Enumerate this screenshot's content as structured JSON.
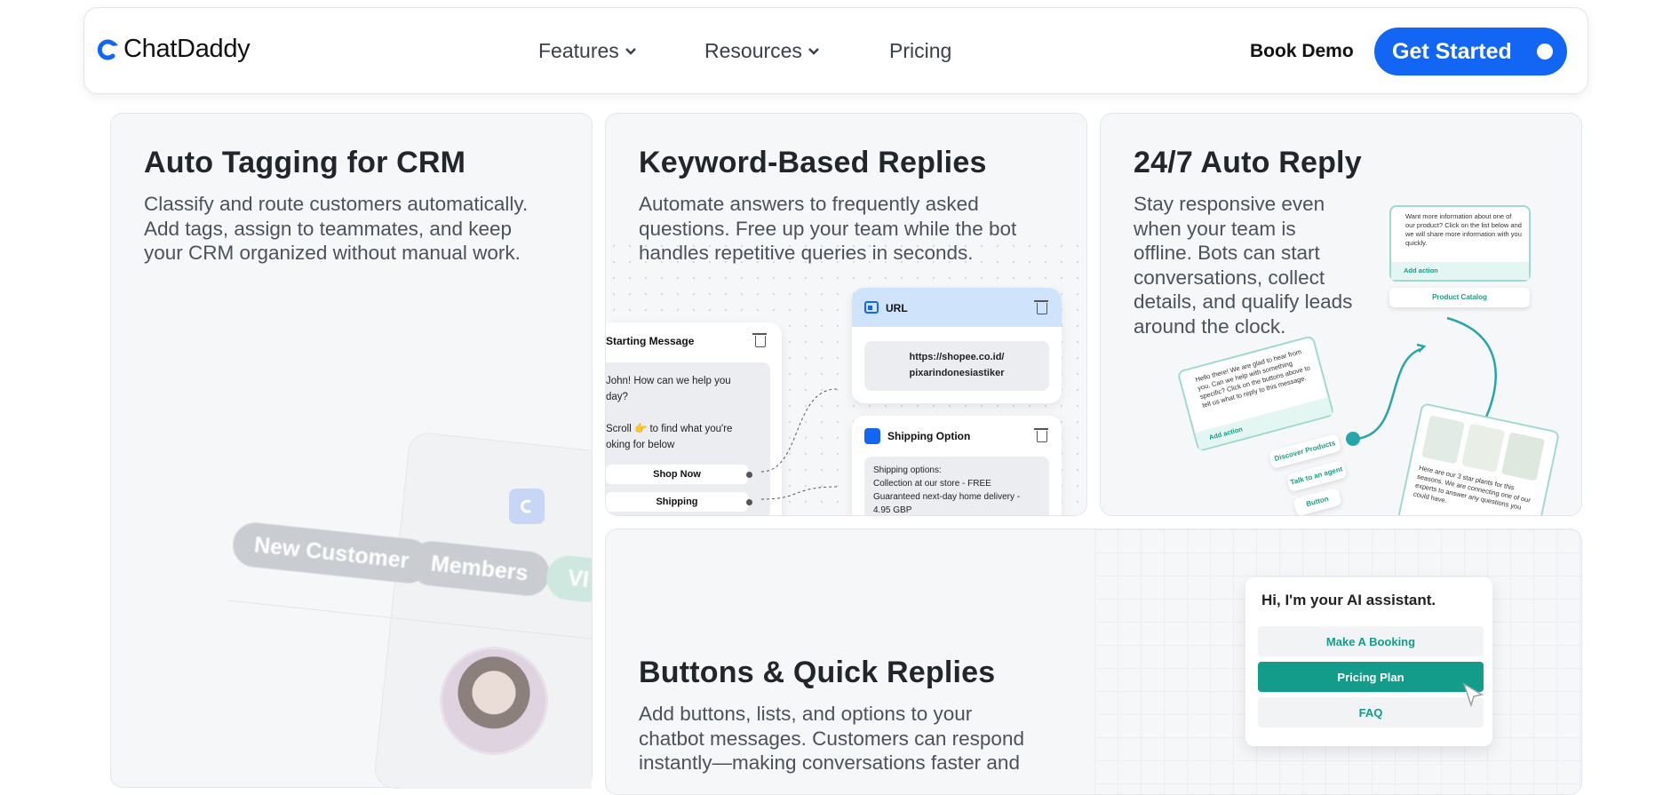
{
  "nav": {
    "brand": "ChatDaddy",
    "links": [
      "Features",
      "Resources",
      "Pricing"
    ],
    "book_demo": "Book Demo",
    "get_started": "Get Started"
  },
  "colors": {
    "accent": "#1366f4",
    "teal": "#149c8a",
    "card_bg": "#f6f7f9"
  },
  "cards": {
    "auto_tagging": {
      "title": "Auto Tagging for CRM",
      "lines": [
        "Classify and route customers automatically.",
        "Add tags, assign to teammates, and keep",
        "your CRM organized without manual work."
      ],
      "tags": [
        "New Customer",
        "Members",
        "VI"
      ]
    },
    "keyword": {
      "title": "Keyword-Based Replies",
      "lines": [
        "Automate answers to frequently asked",
        "questions. Free up your team while the bot",
        "handles repetitive queries in seconds."
      ],
      "start_msg": {
        "head": "Starting Message",
        "body1": "John! How can we help you",
        "body2": "day?",
        "body3": "Scroll 👉 to find what you're",
        "body4": "oking for below",
        "btn1": "Shop Now",
        "btn2": "Shipping"
      },
      "url_card": {
        "head": "URL",
        "value1": "https://shopee.co.id/",
        "value2": "pixarindonesiastiker"
      },
      "shipping_card": {
        "head": "Shipping Option",
        "l1": "Shipping options:",
        "l2": "Collection at our store - FREE",
        "l3": "Guaranteed next-day home delivery -",
        "l4": "4.95 GBP"
      }
    },
    "auto_reply": {
      "title": "24/7 Auto Reply",
      "lines": [
        "Stay responsive even",
        "when your team is",
        "offline. Bots can start",
        "conversations, collect",
        "details, and qualify leads",
        "around the clock."
      ],
      "info_card": "Want more information about one of our product? Click on the list below and we will share more information with you quickly.",
      "add_action": "Add action",
      "product_catalog": "Product Catalog",
      "hello_card": "Hello there! We are glad to hear from you. Can we help with something specific? Click on the buttons above to tell us what to reply to this message.",
      "chips": [
        "Discover Products",
        "Talk to an agent",
        "Button"
      ],
      "plants_card": "Here are our 3 star plants for this seasons. We are connecting one of our experts to answer any questions you could have."
    },
    "buttons": {
      "title": "Buttons & Quick Replies",
      "lines": [
        "Add buttons, lists, and options to your",
        "chatbot messages. Customers can respond",
        "instantly—making conversations faster and"
      ],
      "ai": {
        "title": "Hi, I'm your AI assistant.",
        "options": [
          "Make A Booking",
          "Pricing Plan",
          "FAQ"
        ]
      }
    }
  }
}
